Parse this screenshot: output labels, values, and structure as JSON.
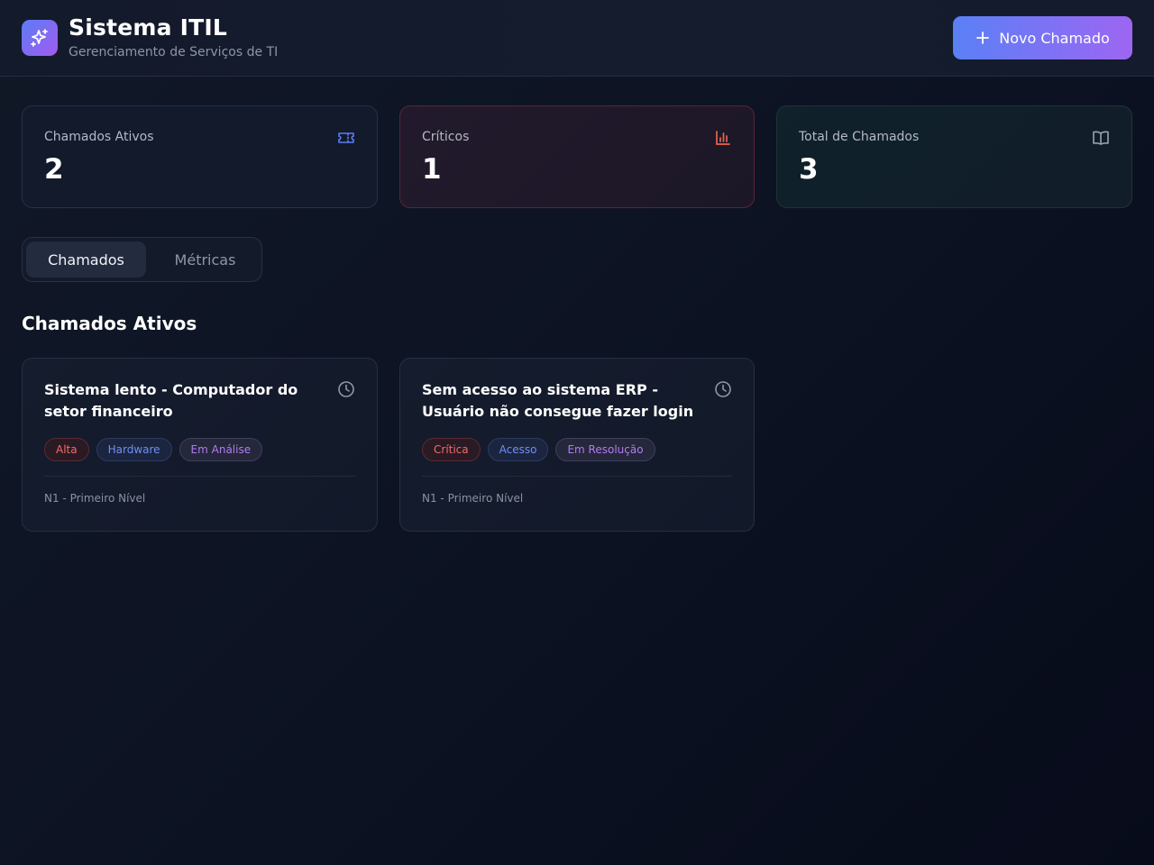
{
  "header": {
    "title": "Sistema ITIL",
    "subtitle": "Gerenciamento de Serviços de TI",
    "new_ticket_label": "Novo Chamado",
    "logo_icon": "sparkles-icon"
  },
  "stats": [
    {
      "label": "Chamados Ativos",
      "value": "2",
      "icon": "ticket-icon",
      "color": "#5b7cf6"
    },
    {
      "label": "Críticos",
      "value": "1",
      "icon": "bar-chart-icon",
      "color": "#e8664a"
    },
    {
      "label": "Total de Chamados",
      "value": "3",
      "icon": "book-open-icon",
      "color": "#9aa2b3"
    }
  ],
  "tabs": [
    {
      "label": "Chamados",
      "active": true
    },
    {
      "label": "Métricas",
      "active": false
    }
  ],
  "section_title": "Chamados Ativos",
  "tickets": [
    {
      "title": "Sistema lento - Computador do setor financeiro",
      "priority": "Alta",
      "category": "Hardware",
      "status": "Em Análise",
      "level": "N1 - Primeiro Nível"
    },
    {
      "title": "Sem acesso ao sistema ERP - Usuário não consegue fazer login",
      "priority": "Crítica",
      "category": "Acesso",
      "status": "Em Resolução",
      "level": "N1 - Primeiro Nível"
    }
  ],
  "colors": {
    "accent_start": "#5a80f6",
    "accent_end": "#9d66f2",
    "priority": "#f26b6b",
    "category": "#6f8ef5",
    "status": "#b07cf0"
  }
}
